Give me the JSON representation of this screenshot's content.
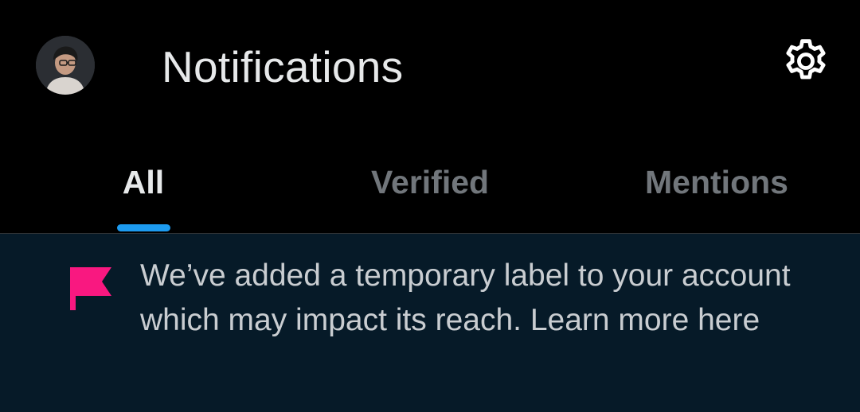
{
  "header": {
    "title": "Notifications",
    "avatar_icon": "user-avatar-icon",
    "settings_icon": "gear-icon"
  },
  "tabs": [
    {
      "label": "All",
      "active": true
    },
    {
      "label": "Verified",
      "active": false
    },
    {
      "label": "Mentions",
      "active": false
    }
  ],
  "banner": {
    "icon": "flag-icon",
    "text": "We’ve added a temporary label to your account which may impact its reach. Learn more here"
  },
  "colors": {
    "background": "#000000",
    "banner_background": "#061a28",
    "accent": "#1d9bf0",
    "flag": "#f91880",
    "text_primary": "#e7e9ea",
    "text_secondary": "#71767b"
  }
}
